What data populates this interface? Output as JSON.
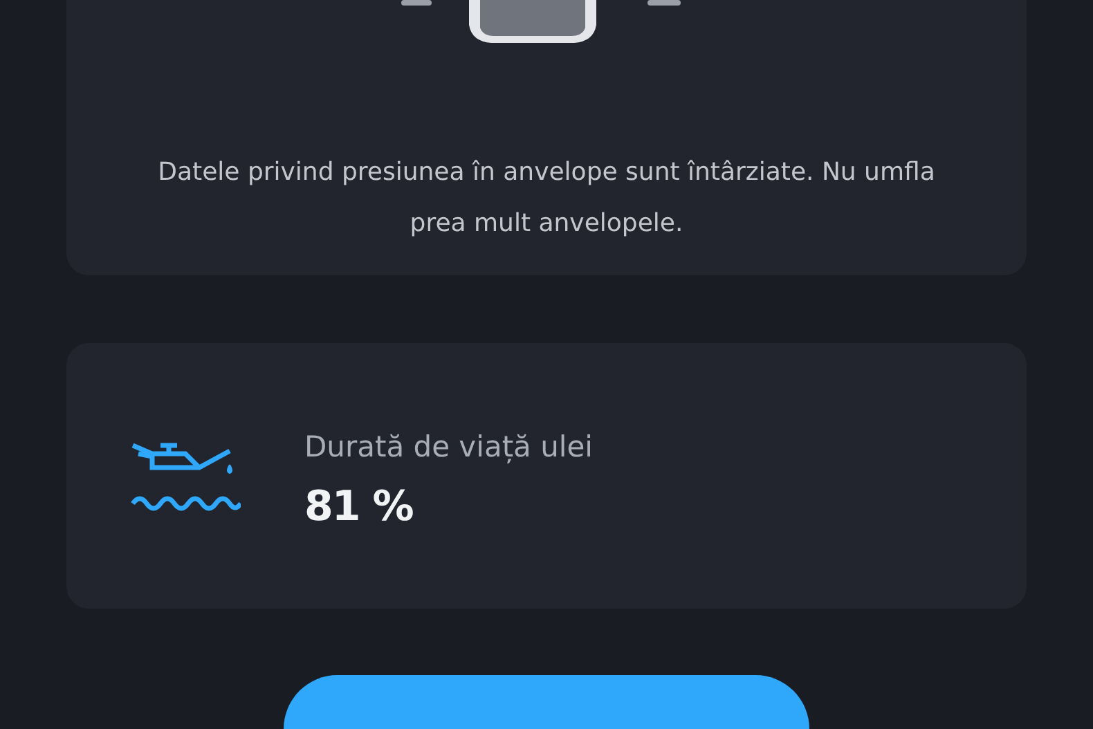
{
  "tire_card": {
    "message": "Datele privind presiunea în anvelope sunt întârziate. Nu umfla prea mult anvelopele."
  },
  "oil_card": {
    "title": "Durată de viață ulei",
    "value": "81 %"
  }
}
